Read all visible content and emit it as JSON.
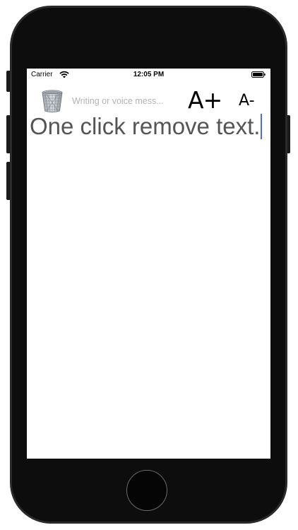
{
  "status_bar": {
    "carrier": "Carrier",
    "time": "12:05 PM"
  },
  "toolbar": {
    "message_placeholder": "Writing or voice mess...",
    "font_increase_label": "A+",
    "font_decrease_label": "A-"
  },
  "content": {
    "text": "One click remove text."
  },
  "icons": {
    "trash": "trash-can-icon",
    "wifi": "wifi-icon",
    "battery": "battery-icon"
  },
  "colors": {
    "text": "#555555",
    "caret": "#4a6fd8",
    "placeholder": "#b3b3b3",
    "bezel": "#0d0d0d"
  }
}
